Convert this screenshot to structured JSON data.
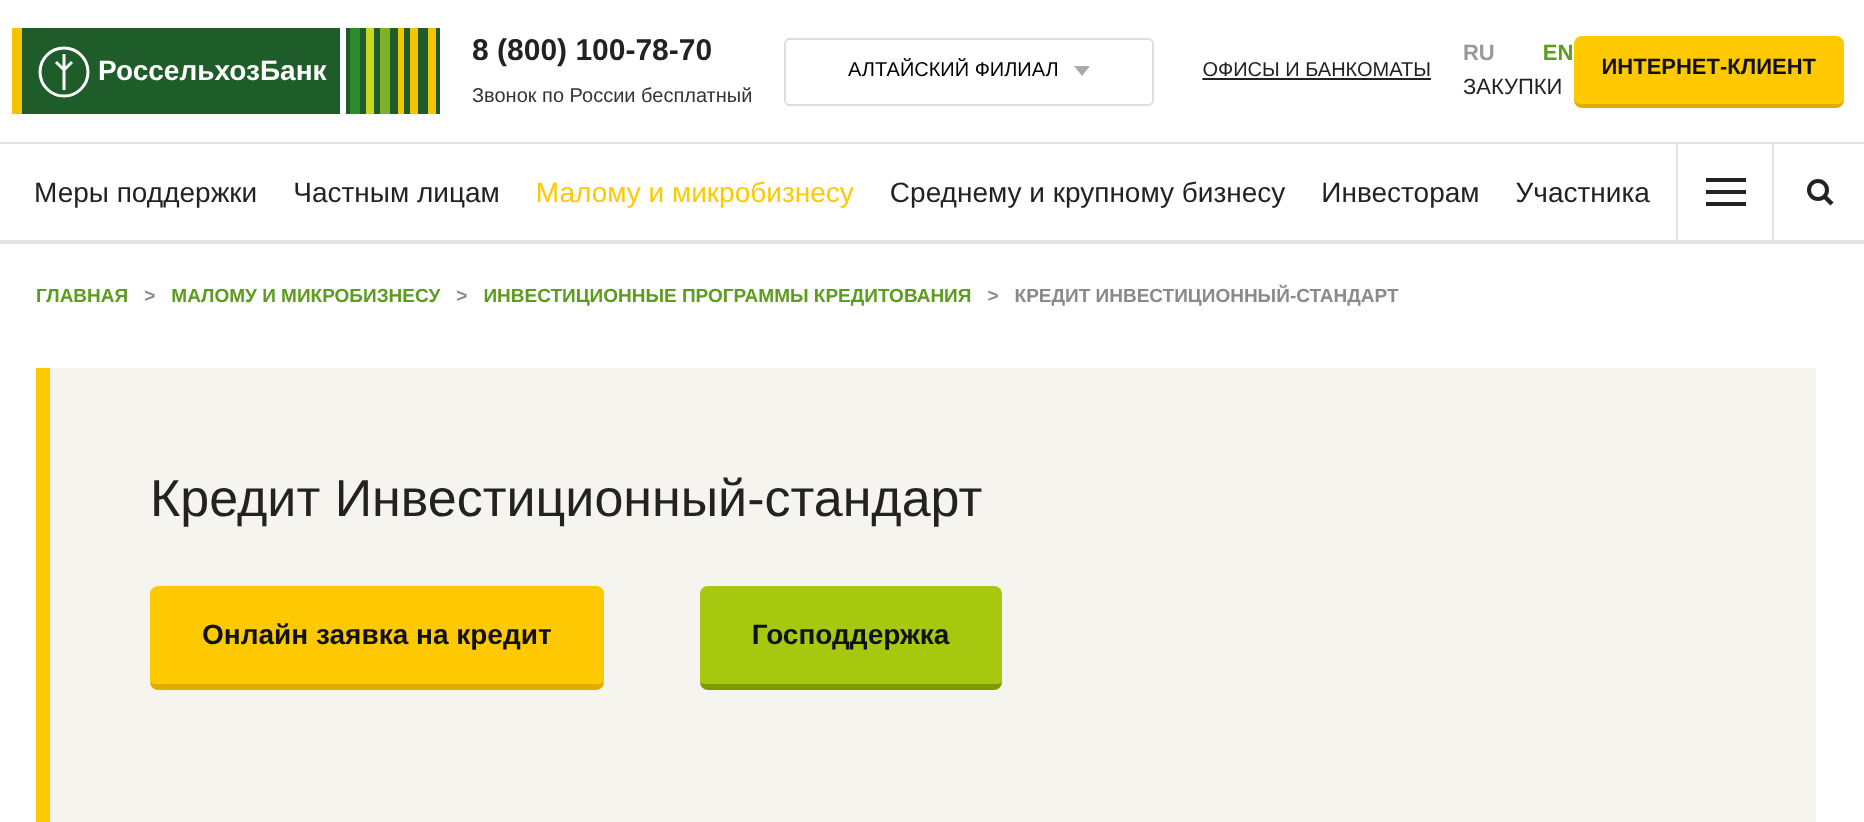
{
  "header": {
    "logo_text": "РоссельхозБанк",
    "phone": "8 (800) 100-78-70",
    "phone_note": "Звонок по России бесплатный",
    "branch": "АЛТАЙСКИЙ ФИЛИАЛ",
    "offices_link": "ОФИСЫ И БАНКОМАТЫ",
    "languages": [
      {
        "label": "RU",
        "selected": true
      },
      {
        "label": "EN",
        "selected": false
      }
    ],
    "purchases_link": "ЗАКУПКИ",
    "client_button": "ИНТЕРНЕТ-КЛИЕНТ"
  },
  "nav": {
    "items": [
      {
        "label": "Меры поддержки",
        "selected": false
      },
      {
        "label": "Частным лицам",
        "selected": false
      },
      {
        "label": "Малому и микробизнесу",
        "selected": true
      },
      {
        "label": "Среднему и крупному бизнесу",
        "selected": false
      },
      {
        "label": "Инвесторам",
        "selected": false
      },
      {
        "label": "Участника",
        "selected": false
      }
    ]
  },
  "breadcrumbs": [
    {
      "label": "ГЛАВНАЯ",
      "kind": "link"
    },
    {
      "label": "МАЛОМУ И МИКРОБИЗНЕСУ",
      "kind": "link"
    },
    {
      "label": "ИНВЕСТИЦИОННЫЕ ПРОГРАММЫ КРЕДИТОВАНИЯ",
      "kind": "link"
    },
    {
      "label": "КРЕДИТ ИНВЕСТИЦИОННЫЙ-СТАНДАРТ",
      "kind": "current"
    }
  ],
  "breadcrumb_separator": ">",
  "hero": {
    "title": "Кредит Инвестиционный-стандарт",
    "buttons": [
      {
        "label": "Онлайн заявка на кредит",
        "kind": "primary"
      },
      {
        "label": "Господдержка",
        "kind": "secondary"
      }
    ]
  }
}
